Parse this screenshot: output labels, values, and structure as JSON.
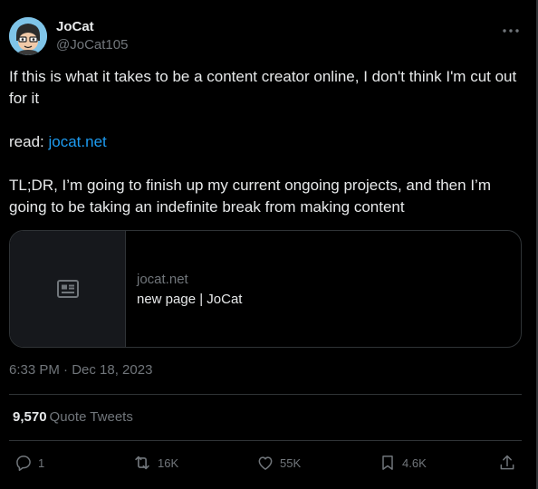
{
  "author": {
    "display_name": "JoCat",
    "handle": "@JoCat105",
    "avatar_icon": "cartoon-avatar"
  },
  "tweet": {
    "line1": "If this is what it takes to be a content creator online, I don't think I'm cut out for it",
    "read_label": "read: ",
    "read_link": "jocat.net",
    "tldr": "TL;DR, I’m going to finish up my current ongoing projects, and then I’m going to be taking an indefinite break from making content",
    "timestamp": "6:33 PM · Dec 18, 2023"
  },
  "card": {
    "domain": "jocat.net",
    "title": "new page | JoCat",
    "thumb_icon": "article-icon"
  },
  "stats": {
    "quote_count": "9,570",
    "quote_label": "Quote Tweets"
  },
  "actions": {
    "replies": "1",
    "retweets": "16K",
    "likes": "55K",
    "bookmarks": "4.6K"
  },
  "colors": {
    "background": "#000000",
    "text": "#e7e9ea",
    "secondary": "#71767b",
    "link": "#1d9bf0",
    "border": "#2f3336"
  }
}
